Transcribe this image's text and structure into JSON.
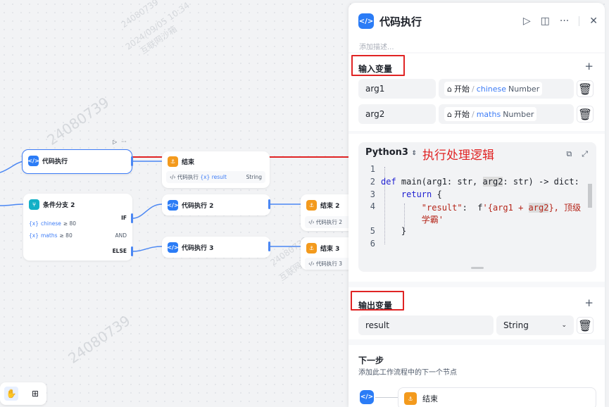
{
  "canvas": {
    "watermarks": [
      "24080739",
      "2024/09/05 10:34",
      "互联网沙箱",
      "24080739",
      "2024/09/05 10:34",
      "互联网沙箱",
      "24080739",
      "2024/09/05 10:34",
      "互联网沙箱",
      "24080739"
    ],
    "selected_node": {
      "title": "代码执行"
    },
    "end_node_1": {
      "title": "结束",
      "ref_source": "代码执行",
      "ref_var": "result",
      "ref_type": "String"
    },
    "condition_node": {
      "title": "条件分支 2",
      "cond1_var": "chinese",
      "cond1_op": "≥ 80",
      "cond2_var": "maths",
      "cond2_op": "≥ 80",
      "if_label": "IF",
      "and_label": "AND",
      "else_label": "ELSE"
    },
    "code_node_2": {
      "title": "代码执行 2"
    },
    "code_node_3": {
      "title": "代码执行 3"
    },
    "end_node_2": {
      "title": "结束 2",
      "ref_source": "代码执行 2"
    },
    "end_node_3": {
      "title": "结束 3",
      "ref_source": "代码执行 3"
    }
  },
  "panel": {
    "title": "代码执行",
    "description_placeholder": "添加描述...",
    "input_section": {
      "title": "输入变量",
      "rows": [
        {
          "name": "arg1",
          "source": "开始",
          "var": "chinese",
          "type": "Number"
        },
        {
          "name": "arg2",
          "source": "开始",
          "var": "maths",
          "type": "Number"
        }
      ]
    },
    "code": {
      "language": "Python3",
      "annotation": "执行处理逻辑",
      "line_numbers": [
        "1",
        "2",
        "3",
        "4",
        "",
        "5",
        "6"
      ]
    },
    "output_section": {
      "title": "输出变量",
      "rows": [
        {
          "name": "result",
          "type": "String"
        }
      ]
    },
    "next_section": {
      "title": "下一步",
      "subtitle": "添加此工作流程中的下一个节点",
      "next_node": "结束"
    }
  },
  "colors": {
    "accent": "#2b7cf6",
    "annotation_red": "#e02424",
    "end_orange": "#f39a1d"
  }
}
